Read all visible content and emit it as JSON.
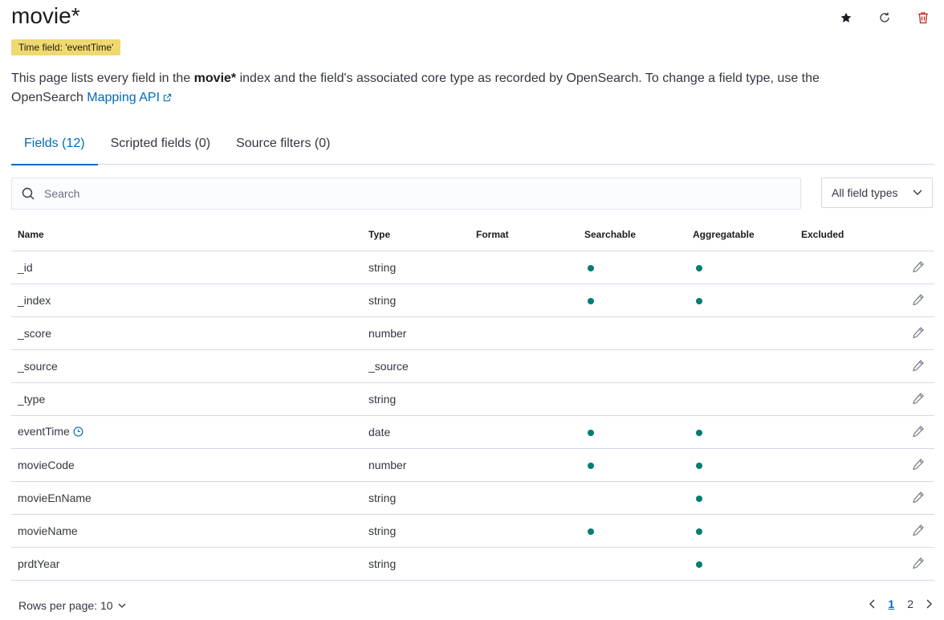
{
  "title": "movie*",
  "time_badge": "Time field: 'eventTime'",
  "description": {
    "pre": "This page lists every field in the ",
    "index_name": "movie*",
    "post": " index and the field's associated core type as recorded by OpenSearch. To change a field type, use the OpenSearch ",
    "link": "Mapping API"
  },
  "header_icons": [
    "star-icon",
    "refresh-icon",
    "trash-icon"
  ],
  "tabs": [
    {
      "label": "Fields (12)",
      "active": true
    },
    {
      "label": "Scripted fields (0)",
      "active": false
    },
    {
      "label": "Source filters (0)",
      "active": false
    }
  ],
  "search": {
    "placeholder": "Search"
  },
  "filter": {
    "label": "All field types"
  },
  "table": {
    "columns": [
      "Name",
      "Type",
      "Format",
      "Searchable",
      "Aggregatable",
      "Excluded"
    ],
    "rows": [
      {
        "name": "_id",
        "type": "string",
        "searchable": true,
        "aggregatable": true
      },
      {
        "name": "_index",
        "type": "string",
        "searchable": true,
        "aggregatable": true
      },
      {
        "name": "_score",
        "type": "number",
        "searchable": false,
        "aggregatable": false
      },
      {
        "name": "_source",
        "type": "_source",
        "searchable": false,
        "aggregatable": false
      },
      {
        "name": "_type",
        "type": "string",
        "searchable": false,
        "aggregatable": false
      },
      {
        "name": "eventTime",
        "type": "date",
        "searchable": true,
        "aggregatable": true,
        "time_field": true
      },
      {
        "name": "movieCode",
        "type": "number",
        "searchable": true,
        "aggregatable": true
      },
      {
        "name": "movieEnName",
        "type": "string",
        "searchable": false,
        "aggregatable": true
      },
      {
        "name": "movieName",
        "type": "string",
        "searchable": true,
        "aggregatable": true
      },
      {
        "name": "prdtYear",
        "type": "string",
        "searchable": false,
        "aggregatable": true
      }
    ]
  },
  "pagination": {
    "rows_per_page_label": "Rows per page: 10",
    "pages": [
      "1",
      "2"
    ],
    "current": "1"
  },
  "colors": {
    "accent": "#006bb8",
    "dot": "#017d73",
    "badge": "#f1d86f",
    "danger": "#bd271e"
  }
}
